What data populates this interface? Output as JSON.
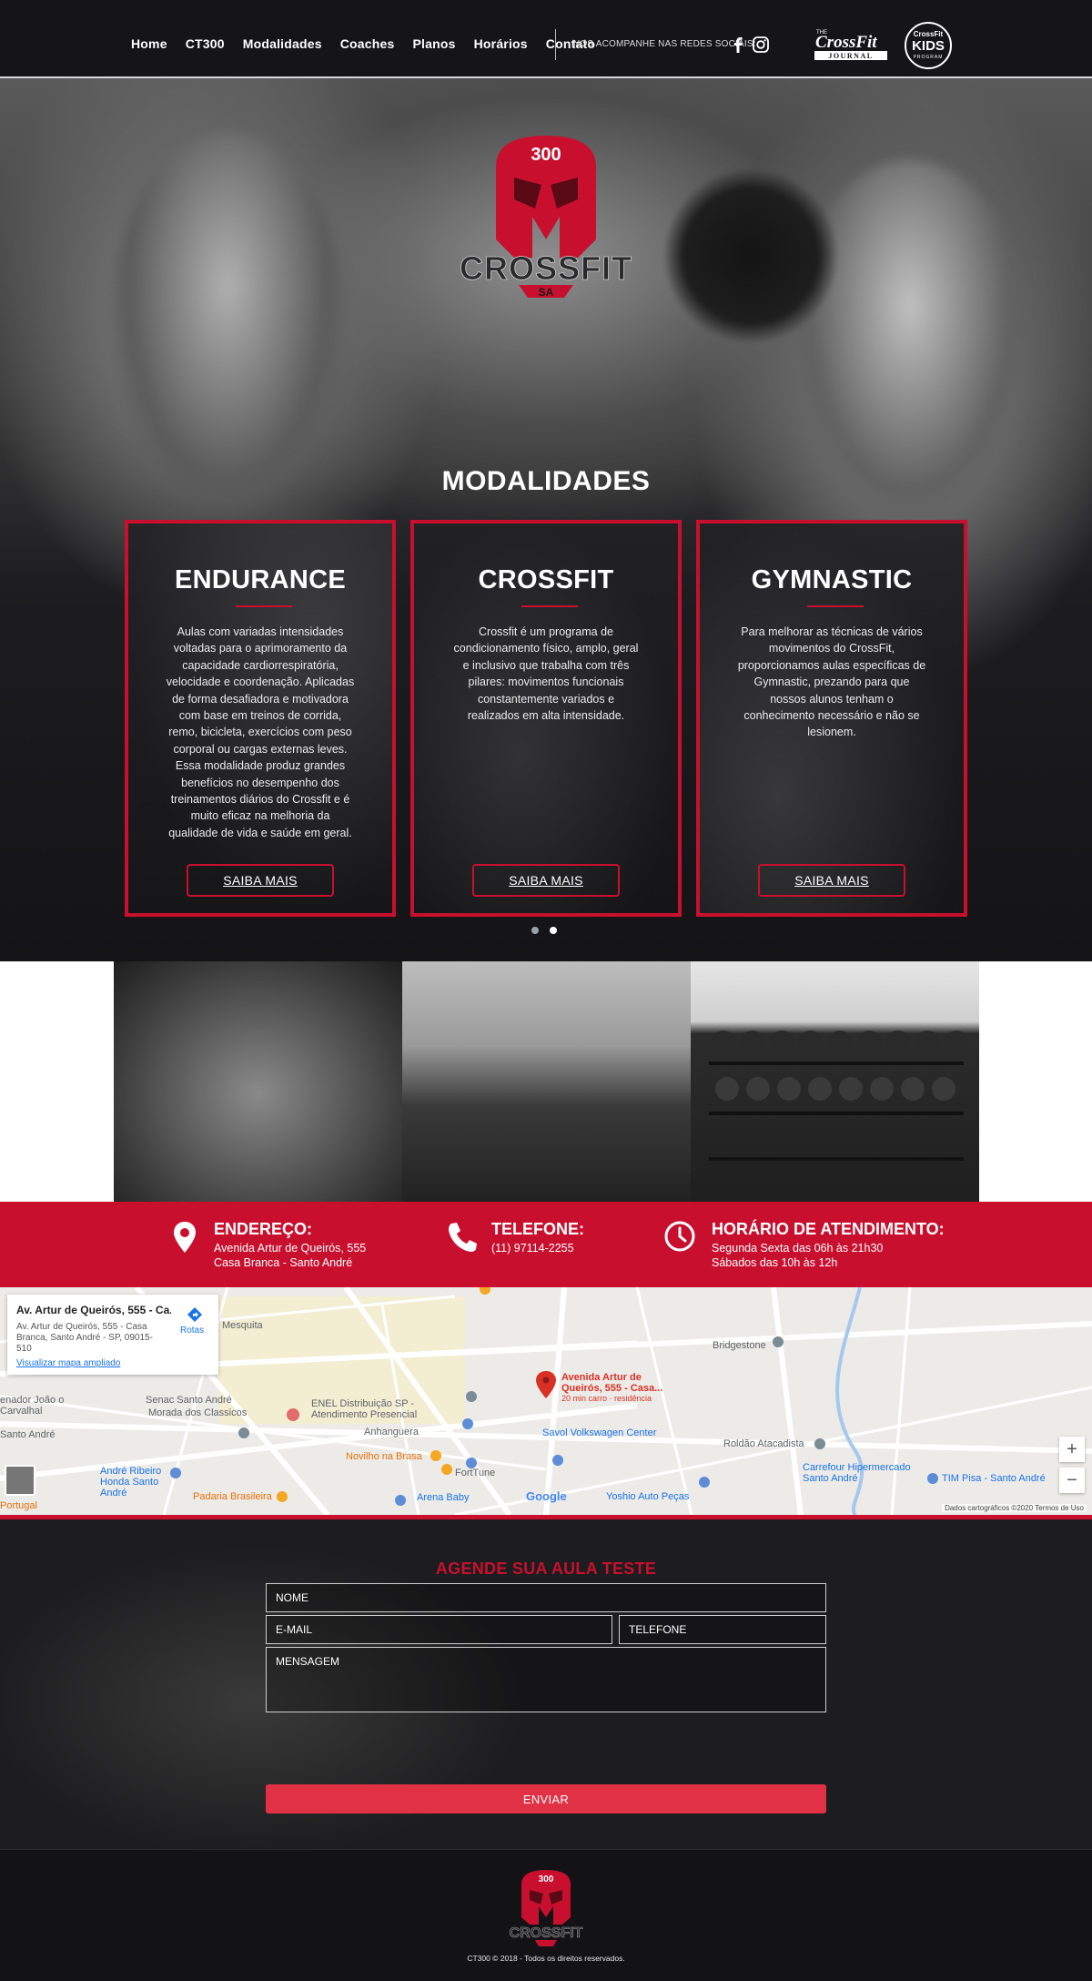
{
  "nav": {
    "items": [
      {
        "label": "Home"
      },
      {
        "label": "CT300"
      },
      {
        "label": "Modalidades"
      },
      {
        "label": "Coaches"
      },
      {
        "label": "Planos"
      },
      {
        "label": "Horários"
      },
      {
        "label": "Contato"
      }
    ],
    "social_label": "NOS ACOMPANHE NAS REDES SOCIAIS:",
    "journal": {
      "top": "THE",
      "main": "CrossFit",
      "bottom": "JOURNAL"
    },
    "kids": {
      "top": "CrossFit",
      "main": "KIDS",
      "bottom": "PROGRAM"
    }
  },
  "logo": {
    "number": "300",
    "word": "CROSSFIT",
    "sub": "SA"
  },
  "modalidades": {
    "title": "MODALIDADES",
    "cards": [
      {
        "title": "ENDURANCE",
        "text": "Aulas com variadas intensidades voltadas para o aprimoramento da capacidade cardiorrespiratória, velocidade e coordenação. Aplicadas de forma desafiadora e motivadora com base em treinos de corrida, remo, bicicleta, exercícios com peso corporal ou cargas externas leves. Essa modalidade produz grandes benefícios no desempenho dos treinamentos diários do Crossfit e é muito eficaz na melhoria da qualidade de vida e saúde em geral.",
        "button": "SAIBA MAIS"
      },
      {
        "title": "CROSSFIT",
        "text": "Crossfit é um programa de condicionamento físico, amplo, geral e inclusivo que trabalha com três pilares: movimentos funcionais constantemente variados e realizados em alta intensidade.",
        "button": "SAIBA MAIS"
      },
      {
        "title": "GYMNASTIC",
        "text": "Para melhorar as técnicas de vários movimentos do CrossFit, proporcionamos aulas específicas de Gymnastic, prezando para que nossos alunos tenham o conhecimento necessário e não se lesionem.",
        "button": "SAIBA MAIS"
      }
    ]
  },
  "info": {
    "address": {
      "title": "ENDEREÇO:",
      "line1": "Avenida Artur de Queirós, 555",
      "line2": "Casa Branca - Santo André"
    },
    "phone": {
      "title": "TELEFONE:",
      "line1": "(11) 97114-2255"
    },
    "hours": {
      "title": "HORÁRIO DE ATENDIMENTO:",
      "line1": "Segunda Sexta das 06h às 21h30",
      "line2": "Sábados das 10h às 12h"
    }
  },
  "map": {
    "card_title": "Av. Artur de Queirós, 555 - Ca...",
    "card_address": "Av. Artur de Queirós, 555 - Casa Branca, Santo André - SP, 09015-510",
    "card_link": "Visualizar mapa ampliado",
    "routes": "Rotas",
    "pin_label": "Avenida Artur de Queirós, 555 - Casa...",
    "pin_sub": "20 min carro · residência",
    "attribution": "Dados cartográficos ©2020   Termos de Uso",
    "google": "Google",
    "places": [
      "Mesquita",
      "Bridgestone",
      "Senac Santo André",
      "Morada dos Classicos",
      "ENEL Distribuição SP - Atendimento Presencial",
      "Anhanguera",
      "Savol Volkswagen Center",
      "Roldão Atacadista",
      "Carrefour Hipermercado Santo André",
      "TIM Pisa - Santo André",
      "Novilho na Brasa",
      "FortTune",
      "André Ribeiro Honda Santo André",
      "Arena Baby",
      "Yoshio Auto Peças",
      "Padaria Brasileira",
      "Santo André",
      "enador João o Carvalhal",
      "Portugal"
    ]
  },
  "form": {
    "title": "AGENDE SUA AULA TESTE",
    "name_ph": "NOME",
    "email_ph": "E-MAIL",
    "phone_ph": "TELEFONE",
    "message_ph": "MENSAGEM",
    "submit": "ENVIAR"
  },
  "footer": {
    "copyright": "CT300 © 2018 - Todos os direitos reservados."
  },
  "colors": {
    "accent": "#c8102e",
    "dark": "#131316",
    "button": "#e03244"
  }
}
